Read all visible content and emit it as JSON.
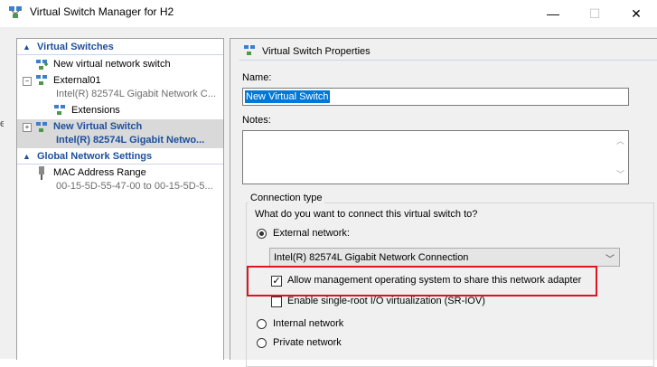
{
  "window": {
    "title": "Virtual Switch Manager for H2",
    "minimize": "—",
    "maximize": "☐",
    "close": "✕"
  },
  "tree": {
    "virtual_switches_header": "Virtual Switches",
    "new_switch": "New virtual network switch",
    "external01": {
      "name": "External01",
      "adapter": "Intel(R) 82574L Gigabit Network C...",
      "extensions": "Extensions"
    },
    "selected": {
      "name": "New Virtual Switch",
      "adapter": "Intel(R) 82574L Gigabit Netwo..."
    },
    "global_header": "Global Network Settings",
    "mac": {
      "name": "MAC Address Range",
      "range": "00-15-5D-55-47-00 to 00-15-5D-5..."
    }
  },
  "properties": {
    "header": "Virtual Switch Properties",
    "name_label": "Name:",
    "name_value": "New Virtual Switch",
    "notes_label": "Notes:",
    "notes_value": "",
    "connection_type": {
      "legend": "Connection type",
      "question": "What do you want to connect this virtual switch to?",
      "external_label": "External network:",
      "external_selected": true,
      "adapter_value": "Intel(R) 82574L Gigabit Network Connection",
      "allow_mgmt_label": "Allow management operating system to share this network adapter",
      "allow_mgmt_checked": true,
      "sriov_label": "Enable single-root I/O virtualization (SR-IOV)",
      "sriov_checked": false,
      "internal_label": "Internal network",
      "private_label": "Private network"
    }
  },
  "colors": {
    "accent_blue": "#1c4f9c",
    "selection_blue": "#0078d7",
    "highlight_red": "#e0141e"
  },
  "icons": {
    "app": "network-switch-icon",
    "switch": "network-switch-icon",
    "new_switch": "add-switch-icon",
    "mac": "network-plug-icon"
  }
}
